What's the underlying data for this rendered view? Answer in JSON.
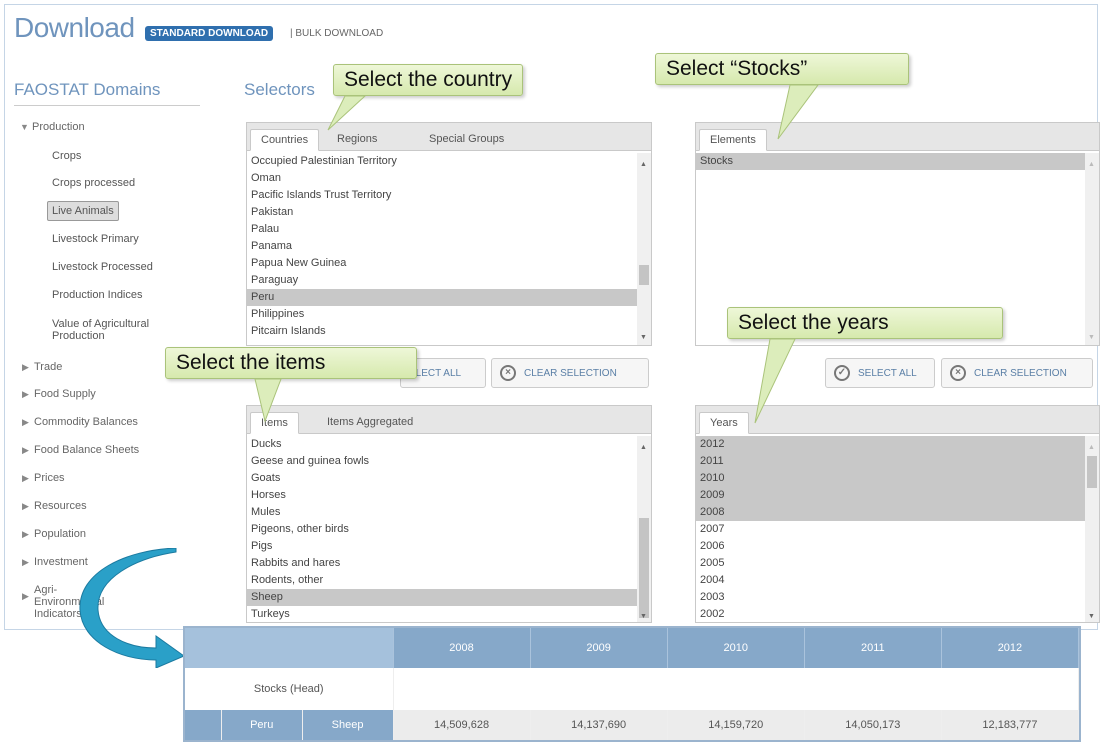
{
  "header": {
    "title": "Download",
    "standard_label": "STANDARD DOWNLOAD",
    "bulk_label": "| BULK DOWNLOAD"
  },
  "sidebar": {
    "title": "FAOSTAT Domains",
    "production": "Production",
    "sub": [
      "Crops",
      "Crops processed",
      "Live Animals",
      "Livestock Primary",
      "Livestock Processed",
      "Production Indices",
      "Value of Agricultural Production"
    ],
    "groups": [
      "Trade",
      "Food Supply",
      "Commodity Balances",
      "Food Balance Sheets",
      "Prices",
      "Resources",
      "Population",
      "Investment",
      "Agri-Environmental Indicators"
    ]
  },
  "selectors_title": "Selectors",
  "countries": {
    "tabs": [
      "Countries",
      "Regions",
      "Special Groups"
    ],
    "items": [
      "Occupied Palestinian Territory",
      "Oman",
      "Pacific Islands Trust Territory",
      "Pakistan",
      "Palau",
      "Panama",
      "Papua New Guinea",
      "Paraguay",
      "Peru",
      "Philippines",
      "Pitcairn Islands"
    ]
  },
  "elements": {
    "tabs": [
      "Elements"
    ],
    "items": [
      "Stocks"
    ]
  },
  "items": {
    "tabs": [
      "Items",
      "Items Aggregated"
    ],
    "items": [
      "Ducks",
      "Geese and guinea fowls",
      "Goats",
      "Horses",
      "Mules",
      "Pigeons, other birds",
      "Pigs",
      "Rabbits and hares",
      "Rodents, other",
      "Sheep",
      "Turkeys"
    ]
  },
  "years": {
    "tabs": [
      "Years"
    ],
    "items": [
      "2012",
      "2011",
      "2010",
      "2009",
      "2008",
      "2007",
      "2006",
      "2005",
      "2004",
      "2003",
      "2002"
    ]
  },
  "buttons": {
    "select_all_partial": "ELECT ALL",
    "select_all": "SELECT ALL",
    "clear": "CLEAR SELECTION"
  },
  "callouts": {
    "country": "Select  the country",
    "stocks": "Select  “Stocks”",
    "items": "Select the items",
    "years": "Select  the years"
  },
  "table": {
    "years": [
      "2008",
      "2009",
      "2010",
      "2011",
      "2012"
    ],
    "element": "Stocks (Head)",
    "country": "Peru",
    "item": "Sheep",
    "values": [
      "14,509,628",
      "14,137,690",
      "14,159,720",
      "14,050,173",
      "12,183,777"
    ]
  },
  "colors": {
    "accent": "#6f94bd",
    "button": "#2f6fae",
    "callout": "#d6e9ad",
    "table_header": "#86a8c9",
    "arrow": "#2aa0c8"
  }
}
